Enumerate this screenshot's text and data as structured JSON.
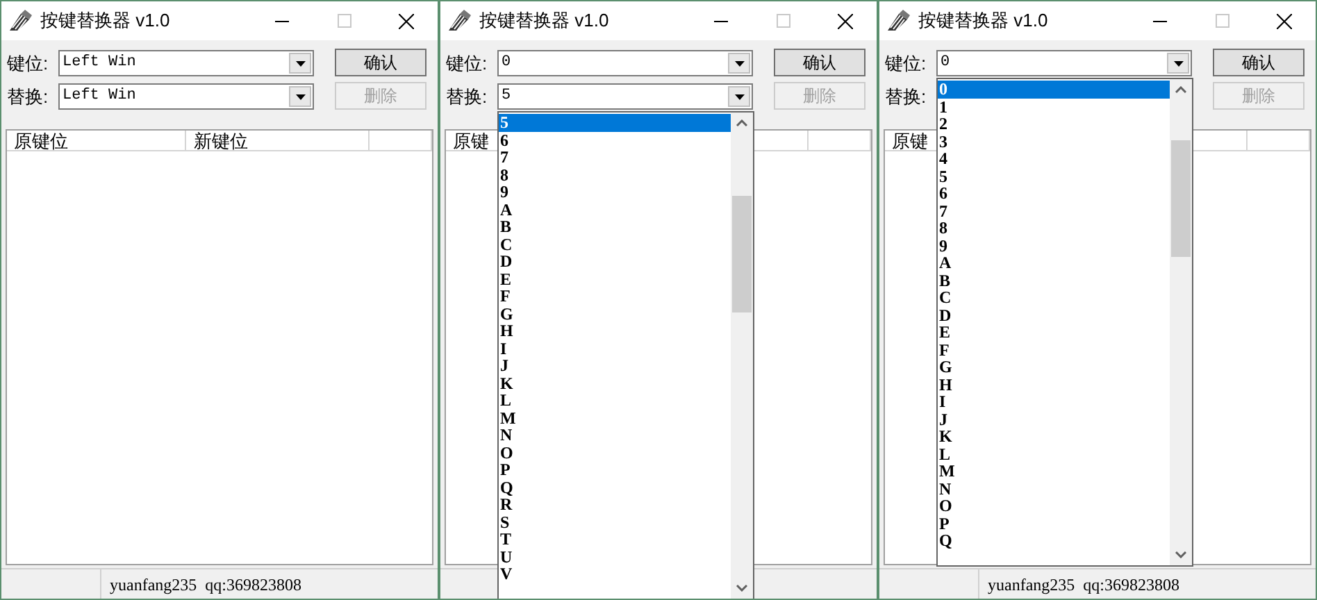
{
  "windows": [
    {
      "title": "按键替换器 v1.0",
      "fields": [
        {
          "label": "键位:",
          "value": "Left Win"
        },
        {
          "label": "替换:",
          "value": "Left Win"
        }
      ],
      "buttons": [
        {
          "label": "确认",
          "disabled": false
        },
        {
          "label": "删除",
          "disabled": true
        }
      ],
      "columns": [
        "原键位",
        "新键位"
      ],
      "status": "yuanfang235  qq:369823808"
    },
    {
      "title": "按键替换器 v1.0",
      "fields": [
        {
          "label": "键位:",
          "value": "0"
        },
        {
          "label": "替换:",
          "value": "5",
          "dropdown": {
            "items": [
              {
                "label": "5",
                "selected": true
              },
              {
                "label": "6",
                "selected": false
              },
              {
                "label": "7",
                "selected": false
              },
              {
                "label": "8",
                "selected": false
              },
              {
                "label": "9",
                "selected": false
              },
              {
                "label": "A",
                "selected": false
              },
              {
                "label": "B",
                "selected": false
              },
              {
                "label": "C",
                "selected": false
              },
              {
                "label": "D",
                "selected": false
              },
              {
                "label": "E",
                "selected": false
              },
              {
                "label": "F",
                "selected": false
              },
              {
                "label": "G",
                "selected": false
              },
              {
                "label": "H",
                "selected": false
              },
              {
                "label": "I",
                "selected": false
              },
              {
                "label": "J",
                "selected": false
              },
              {
                "label": "K",
                "selected": false
              },
              {
                "label": "L",
                "selected": false
              },
              {
                "label": "M",
                "selected": false
              },
              {
                "label": "N",
                "selected": false
              },
              {
                "label": "O",
                "selected": false
              },
              {
                "label": "P",
                "selected": false
              },
              {
                "label": "Q",
                "selected": false
              },
              {
                "label": "R",
                "selected": false
              },
              {
                "label": "S",
                "selected": false
              },
              {
                "label": "T",
                "selected": false
              },
              {
                "label": "U",
                "selected": false
              },
              {
                "label": "V",
                "selected": false
              }
            ]
          }
        }
      ],
      "buttons": [
        {
          "label": "确认",
          "disabled": false
        },
        {
          "label": "删除",
          "disabled": true
        }
      ],
      "columns": [
        "原键"
      ]
    },
    {
      "title": "按键替换器 v1.0",
      "fields": [
        {
          "label": "键位:",
          "value": "0",
          "dropdown": {
            "items": [
              {
                "label": "0",
                "selected": true
              },
              {
                "label": "1",
                "selected": false
              },
              {
                "label": "2",
                "selected": false
              },
              {
                "label": "3",
                "selected": false
              },
              {
                "label": "4",
                "selected": false
              },
              {
                "label": "5",
                "selected": false
              },
              {
                "label": "6",
                "selected": false
              },
              {
                "label": "7",
                "selected": false
              },
              {
                "label": "8",
                "selected": false
              },
              {
                "label": "9",
                "selected": false
              },
              {
                "label": "A",
                "selected": false
              },
              {
                "label": "B",
                "selected": false
              },
              {
                "label": "C",
                "selected": false
              },
              {
                "label": "D",
                "selected": false
              },
              {
                "label": "E",
                "selected": false
              },
              {
                "label": "F",
                "selected": false
              },
              {
                "label": "G",
                "selected": false
              },
              {
                "label": "H",
                "selected": false
              },
              {
                "label": "I",
                "selected": false
              },
              {
                "label": "J",
                "selected": false
              },
              {
                "label": "K",
                "selected": false
              },
              {
                "label": "L",
                "selected": false
              },
              {
                "label": "M",
                "selected": false
              },
              {
                "label": "N",
                "selected": false
              },
              {
                "label": "O",
                "selected": false
              },
              {
                "label": "P",
                "selected": false
              },
              {
                "label": "Q",
                "selected": false
              }
            ]
          }
        },
        {
          "label": "替换:"
        }
      ],
      "buttons": [
        {
          "label": "确认",
          "disabled": false
        },
        {
          "label": "删除",
          "disabled": true
        }
      ],
      "columns": [
        "原键"
      ],
      "status": "yuanfang235  qq:369823808"
    }
  ]
}
